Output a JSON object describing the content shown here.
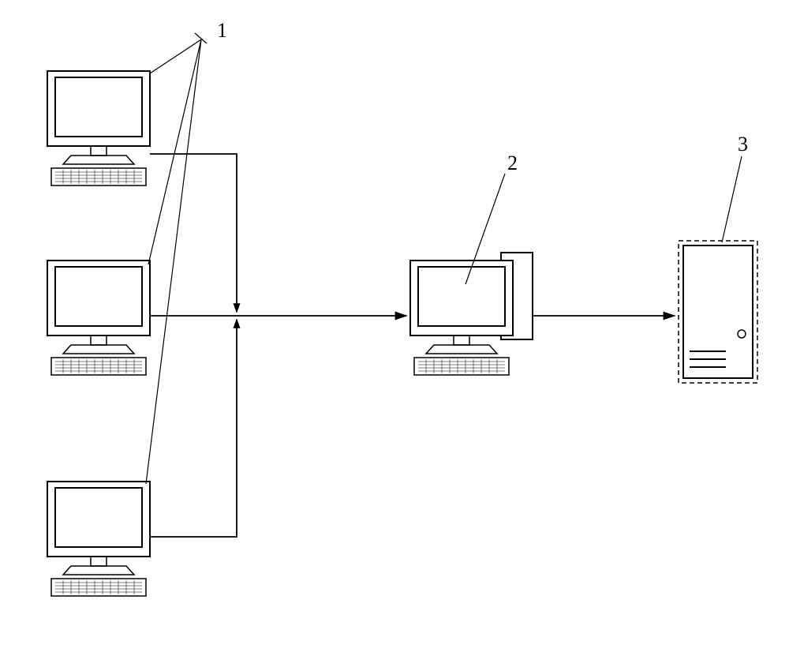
{
  "labels": {
    "one": "1",
    "two": "2",
    "three": "3"
  },
  "diagram": {
    "nodes": {
      "client_a": {
        "type": "computer",
        "label_ref": "one"
      },
      "client_b": {
        "type": "computer",
        "label_ref": "one"
      },
      "client_c": {
        "type": "computer",
        "label_ref": "one"
      },
      "workstation": {
        "type": "computer_with_tower",
        "label_ref": "two"
      },
      "server": {
        "type": "server_rack",
        "label_ref": "three"
      }
    },
    "edges": [
      {
        "from": "client_a",
        "to": "workstation",
        "style": "merge_down"
      },
      {
        "from": "client_b",
        "to": "workstation",
        "style": "direct"
      },
      {
        "from": "client_c",
        "to": "workstation",
        "style": "merge_up"
      },
      {
        "from": "workstation",
        "to": "server",
        "style": "direct"
      }
    ],
    "label_links": [
      {
        "from_label": "one",
        "to_nodes": [
          "client_a",
          "client_b",
          "client_c"
        ]
      },
      {
        "from_label": "two",
        "to_nodes": [
          "workstation"
        ]
      },
      {
        "from_label": "three",
        "to_nodes": [
          "server"
        ]
      }
    ]
  }
}
